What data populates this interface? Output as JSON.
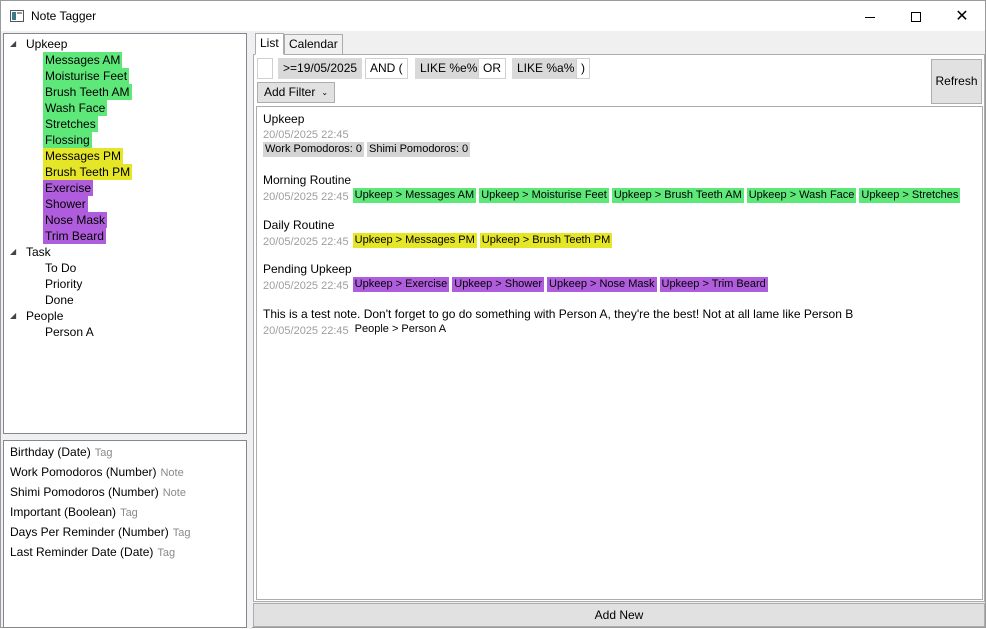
{
  "window": {
    "title": "Note Tagger"
  },
  "colors": {
    "green": "#5ee87a",
    "yellow": "#e6e629",
    "purple": "#b05ddd",
    "grey_tag": "#d4d4d4",
    "none": "transparent"
  },
  "tree": [
    {
      "label": "Upkeep",
      "level": 0,
      "expanded": true,
      "color": "none"
    },
    {
      "label": "Messages AM",
      "level": 1,
      "color": "green"
    },
    {
      "label": "Moisturise Feet",
      "level": 1,
      "color": "green"
    },
    {
      "label": "Brush Teeth AM",
      "level": 1,
      "color": "green"
    },
    {
      "label": "Wash Face",
      "level": 1,
      "color": "green"
    },
    {
      "label": "Stretches",
      "level": 1,
      "color": "green"
    },
    {
      "label": "Flossing",
      "level": 1,
      "color": "green"
    },
    {
      "label": "Messages PM",
      "level": 1,
      "color": "yellow"
    },
    {
      "label": "Brush Teeth PM",
      "level": 1,
      "color": "yellow"
    },
    {
      "label": "Exercise",
      "level": 1,
      "color": "purple"
    },
    {
      "label": "Shower",
      "level": 1,
      "color": "purple"
    },
    {
      "label": "Nose Mask",
      "level": 1,
      "color": "purple"
    },
    {
      "label": "Trim Beard",
      "level": 1,
      "color": "purple"
    },
    {
      "label": "Task",
      "level": 0,
      "expanded": true,
      "color": "none"
    },
    {
      "label": "To Do",
      "level": 1,
      "color": "none"
    },
    {
      "label": "Priority",
      "level": 1,
      "color": "none"
    },
    {
      "label": "Done",
      "level": 1,
      "color": "none"
    },
    {
      "label": "People",
      "level": 0,
      "expanded": true,
      "color": "none"
    },
    {
      "label": "Person A",
      "level": 1,
      "color": "none"
    }
  ],
  "fields": [
    {
      "name": "Birthday (Date)",
      "kind": "Tag"
    },
    {
      "name": "Work Pomodoros (Number)",
      "kind": "Note"
    },
    {
      "name": "Shimi Pomodoros (Number)",
      "kind": "Note"
    },
    {
      "name": "Important (Boolean)",
      "kind": "Tag"
    },
    {
      "name": "Days Per Reminder (Number)",
      "kind": "Tag"
    },
    {
      "name": "Last Reminder Date (Date)",
      "kind": "Tag"
    }
  ],
  "tabs": [
    {
      "label": "List",
      "active": true
    },
    {
      "label": "Calendar",
      "active": false
    }
  ],
  "filters": [
    {
      "label": "",
      "style": "plain"
    },
    {
      "label": ">=19/05/2025",
      "style": "grey"
    },
    {
      "label": "AND (",
      "style": "plain"
    },
    {
      "label": "LIKE %e%",
      "style": "grey"
    },
    {
      "label": "OR",
      "style": "plain"
    },
    {
      "label": "LIKE %a%",
      "style": "grey"
    },
    {
      "label": ")",
      "style": "plain"
    }
  ],
  "add_filter_label": "Add Filter",
  "refresh_label": "Refresh",
  "notes": [
    {
      "title": "Upkeep",
      "date": "20/05/2025 22:45",
      "date_on_own_line": true,
      "tags": [
        {
          "label": "Work Pomodoros: 0",
          "color": "grey_tag"
        },
        {
          "label": "Shimi Pomodoros: 0",
          "color": "grey_tag"
        }
      ]
    },
    {
      "title": "Morning Routine",
      "date": "20/05/2025 22:45",
      "tags": [
        {
          "label": "Upkeep > Messages AM",
          "color": "green"
        },
        {
          "label": "Upkeep > Moisturise Feet",
          "color": "green"
        },
        {
          "label": "Upkeep > Brush Teeth AM",
          "color": "green"
        },
        {
          "label": "Upkeep > Wash Face",
          "color": "green"
        },
        {
          "label": "Upkeep > Stretches",
          "color": "green"
        }
      ]
    },
    {
      "title": "Daily Routine",
      "date": "20/05/2025 22:45",
      "tags": [
        {
          "label": "Upkeep > Messages PM",
          "color": "yellow"
        },
        {
          "label": "Upkeep > Brush Teeth PM",
          "color": "yellow"
        }
      ]
    },
    {
      "title": "Pending Upkeep",
      "date": "20/05/2025 22:45",
      "tags": [
        {
          "label": "Upkeep > Exercise",
          "color": "purple"
        },
        {
          "label": "Upkeep > Shower",
          "color": "purple"
        },
        {
          "label": "Upkeep > Nose Mask",
          "color": "purple"
        },
        {
          "label": "Upkeep > Trim Beard",
          "color": "purple"
        }
      ]
    },
    {
      "title": "This is a test note. Don't forget to go do something with Person A, they're the best! Not at all lame like Person B",
      "date": "20/05/2025 22:45",
      "tags": [
        {
          "label": "People > Person A",
          "color": "none"
        }
      ]
    }
  ],
  "add_new_label": "Add New"
}
